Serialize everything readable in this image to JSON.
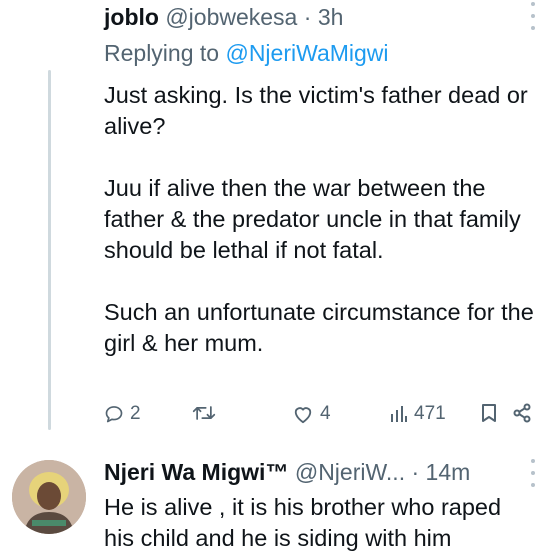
{
  "reply_tweet": {
    "name": "joblo",
    "handle": "@jobwekesa",
    "separator": "·",
    "time": "3h",
    "replying_prefix": "Replying to ",
    "replying_to": "@NjeriWaMigwi",
    "paragraphs": [
      "Just asking. Is the victim's father dead or alive?",
      "Juu if alive then the war between the father & the predator uncle in that family should be lethal if not fatal.",
      "Such an unfortunate circumstance for the girl & her mum."
    ],
    "actions": {
      "replies": "2",
      "retweets": "",
      "likes": "4",
      "views": "471"
    }
  },
  "next_tweet": {
    "name": "Njeri Wa Migwi™",
    "handle": "@NjeriW...",
    "separator": "·",
    "time": "14m",
    "text": "He is alive , it is his brother who raped his child and he is siding with him"
  },
  "icons": {
    "reply": "reply-icon",
    "retweet": "retweet-icon",
    "like": "heart-icon",
    "views": "views-icon",
    "bookmark": "bookmark-icon",
    "share": "share-icon",
    "more": "more-icon"
  },
  "colors": {
    "text": "#0f1419",
    "secondary": "#536471",
    "link": "#1d9bf0",
    "thread_line": "#cfd9de"
  }
}
